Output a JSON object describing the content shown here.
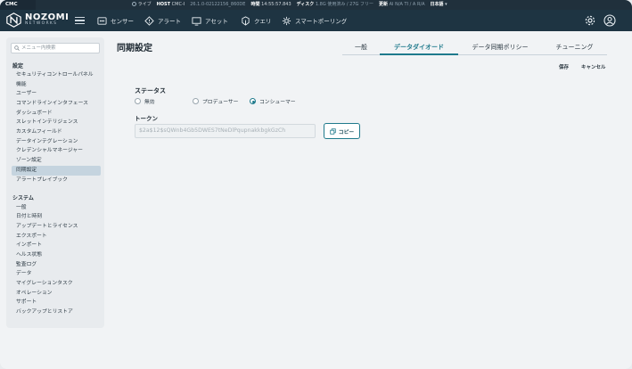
{
  "status_bar": {
    "env": "CMC",
    "live": "ライブ",
    "host_label": "HOST",
    "host_value": "CMC-I",
    "version": "26.1.0-02122156_860DE",
    "time_label": "時間",
    "time_value": "14:55:57.843",
    "disk_label": "ディスク",
    "disk_value": "1.8G 使用済み / 27G フリー",
    "update_label": "更新",
    "update_value": "AI N/A TI / A R/A",
    "language": "日本語"
  },
  "brand": {
    "word1": "NOZOMI",
    "word2": "NETWORKS"
  },
  "nav": {
    "items": [
      {
        "label": "センサー",
        "icon": "sensor-icon"
      },
      {
        "label": "アラート",
        "icon": "alert-icon"
      },
      {
        "label": "アセット",
        "icon": "monitor-icon"
      },
      {
        "label": "クエリ",
        "icon": "query-icon"
      },
      {
        "label": "スマートポーリング",
        "icon": "polling-icon"
      }
    ]
  },
  "sidebar": {
    "search_placeholder": "メニュー内検索",
    "section_settings": "設定",
    "settings_items": [
      "セキュリティコントロールパネル",
      "機能",
      "ユーザー",
      "コマンドラインインタフェース",
      "ダッシュボード",
      "スレットインテリジェンス",
      "カスタムフィールド",
      "データインテグレーション",
      "クレデンシャルマネージャー",
      "ゾーン設定",
      "同期設定",
      "アラートプレイブック"
    ],
    "active_item": "同期設定",
    "section_system": "システム",
    "system_items": [
      "一般",
      "日付と時刻",
      "アップデートとライセンス",
      "エクスポート",
      "インポート",
      "ヘルス状態",
      "監査ログ",
      "データ",
      "マイグレーションタスク",
      "オペレーション",
      "サポート",
      "バックアップとリストア"
    ]
  },
  "page": {
    "title": "同期設定",
    "tabs": [
      "一般",
      "データダイオード",
      "データ同期ポリシー",
      "チューニング"
    ],
    "active_tab": "データダイオード",
    "save": "保存",
    "cancel": "キャンセル",
    "status_label": "ステータス",
    "status_options": [
      "無効",
      "プロデューサー",
      "コンシューマー"
    ],
    "status_selected": "コンシューマー",
    "token_label": "トークン",
    "token_value": "$2a$12$sQWnb4Gb5DWES7tNeDlPqupnakkbgkGzCh",
    "copy_button": "コピー"
  }
}
